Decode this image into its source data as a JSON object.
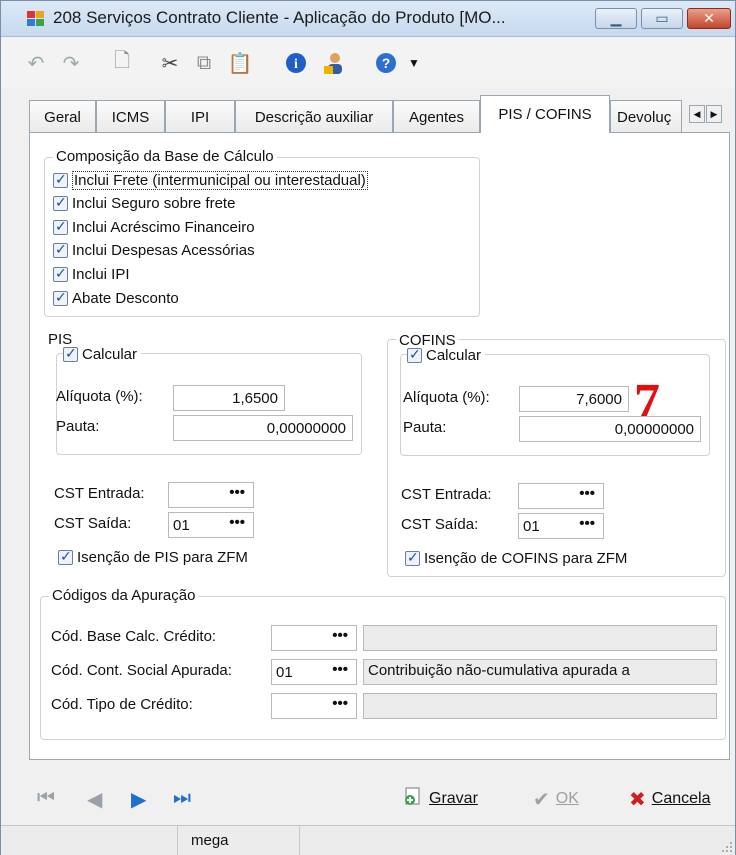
{
  "window": {
    "title": "208 Serviços Contrato Cliente - Aplicação do Produto [MO...",
    "accent": "#c8d9ee",
    "close_color": "#c4452c"
  },
  "toolbar": {
    "icons": [
      "undo-icon",
      "redo-icon",
      "new-document-icon",
      "cut-icon",
      "copy-icon",
      "paste-icon",
      "info-icon",
      "user-icon",
      "help-icon",
      "dropdown-arrow-icon"
    ]
  },
  "tabs": [
    {
      "label": "Geral"
    },
    {
      "label": "ICMS"
    },
    {
      "label": "IPI"
    },
    {
      "label": "Descrição auxiliar"
    },
    {
      "label": "Agentes"
    },
    {
      "label": "PIS / COFINS",
      "active": true
    },
    {
      "label": "Devoluç"
    }
  ],
  "composicao": {
    "title": "Composição da Base de Cálculo",
    "items": [
      {
        "label": "Inclui Frete (intermunicipal ou interestadual)",
        "checked": true
      },
      {
        "label": "Inclui Seguro sobre frete",
        "checked": true
      },
      {
        "label": "Inclui Acréscimo Financeiro",
        "checked": true
      },
      {
        "label": "Inclui Despesas Acessórias",
        "checked": true
      },
      {
        "label": "Inclui IPI",
        "checked": true
      },
      {
        "label": "Abate Desconto",
        "checked": true
      }
    ]
  },
  "annotation": {
    "text": "7",
    "color": "#dd1111"
  },
  "pis": {
    "title": "PIS",
    "calcular_label": "Calcular",
    "aliquota_label": "Alíquota (%):",
    "aliquota_value": "1,6500",
    "pauta_label": "Pauta:",
    "pauta_value": "0,00000000",
    "cst_entrada_label": "CST Entrada:",
    "cst_entrada_value": "",
    "cst_saida_label": "CST Saída:",
    "cst_saida_value": "01",
    "isencao_label": "Isenção de PIS para ZFM"
  },
  "cofins": {
    "title": "COFINS",
    "calcular_label": "Calcular",
    "aliquota_label": "Alíquota (%):",
    "aliquota_value": "7,6000",
    "pauta_label": "Pauta:",
    "pauta_value": "0,00000000",
    "cst_entrada_label": "CST Entrada:",
    "cst_entrada_value": "",
    "cst_saida_label": "CST Saída:",
    "cst_saida_value": "01",
    "isencao_label": "Isenção de COFINS para ZFM"
  },
  "apuracao": {
    "title": "Códigos da Apuração",
    "base_calc_label": "Cód. Base Calc. Crédito:",
    "base_calc_value": "",
    "base_calc_desc": "",
    "cont_social_label": "Cód. Cont. Social Apurada:",
    "cont_social_value": "01",
    "cont_social_desc": "Contribuição não-cumulativa apurada a",
    "tipo_credito_label": "Cód. Tipo de Crédito:",
    "tipo_credito_value": "",
    "tipo_credito_desc": ""
  },
  "lookup_button": "•••",
  "actions": {
    "gravar": "Gravar",
    "ok": "OK",
    "cancela": "Cancela"
  },
  "status": {
    "user": "mega"
  }
}
